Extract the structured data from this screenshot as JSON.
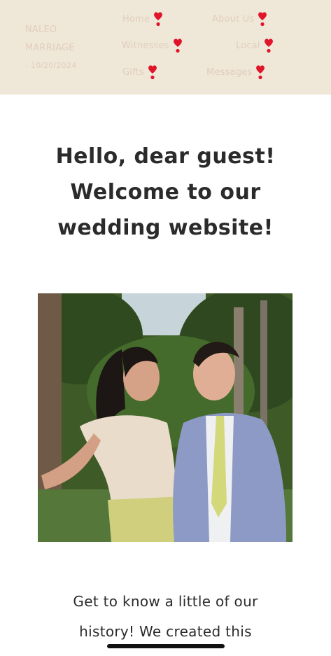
{
  "header": {
    "brand_line1": "NALEO",
    "brand_line2": "MARRIAGE",
    "brand_date": "- 10/20/2024",
    "nav": [
      {
        "label": "Home",
        "icon": "heart-exclamation-icon"
      },
      {
        "label": "About Us",
        "icon": "heart-exclamation-icon"
      },
      {
        "label": "Witnesses",
        "icon": "heart-exclamation-icon"
      },
      {
        "label": "Local",
        "icon": "heart-exclamation-icon"
      },
      {
        "label": "Gifts",
        "icon": "heart-exclamation-icon"
      },
      {
        "label": "Messages",
        "icon": "heart-exclamation-icon"
      }
    ],
    "colors": {
      "background": "#efe8d8",
      "nav_text": "#e2cdbf",
      "icon": "#e0152b"
    }
  },
  "main": {
    "greeting_lines": [
      "Hello, dear guest!",
      "Welcome to our",
      "wedding website!"
    ],
    "history_lines": [
      "Get to know a little of our",
      "history! We created this"
    ]
  }
}
